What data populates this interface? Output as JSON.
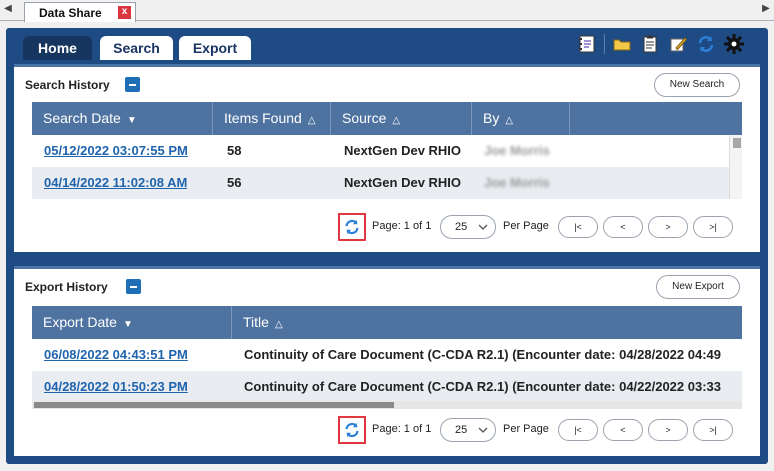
{
  "tabstrip": {
    "tab_label": "Data Share",
    "close_glyph": "x",
    "left_arrow": "◀",
    "right_arrow": "▶"
  },
  "nav": {
    "home": "Home",
    "search": "Search",
    "export": "Export"
  },
  "toolbar": {
    "icons": [
      "notes-icon",
      "folder-icon",
      "clipboard-icon",
      "edit-icon",
      "refresh-icon",
      "gear-icon"
    ]
  },
  "search_history": {
    "title": "Search History",
    "new_button": "New Search",
    "columns": [
      {
        "label": "Search Date",
        "sort": "▼"
      },
      {
        "label": "Items Found",
        "sort": "△"
      },
      {
        "label": "Source",
        "sort": "△"
      },
      {
        "label": "By",
        "sort": "△"
      }
    ],
    "rows": [
      {
        "date": "05/12/2022 03:07:55 PM",
        "items": "58",
        "source": "NextGen Dev RHIO",
        "by": "Joe Morris"
      },
      {
        "date": "04/14/2022 11:02:08 AM",
        "items": "56",
        "source": "NextGen Dev RHIO",
        "by": "Joe Morris"
      }
    ],
    "pager": {
      "page_text": "Page: 1 of 1",
      "page_size": "25",
      "per_page": "Per Page",
      "first": "|<",
      "prev": "<",
      "next": ">",
      "last": ">|"
    }
  },
  "export_history": {
    "title": "Export History",
    "new_button": "New Export",
    "columns": [
      {
        "label": "Export Date",
        "sort": "▼"
      },
      {
        "label": "Title",
        "sort": "△"
      }
    ],
    "rows": [
      {
        "date": "06/08/2022 04:43:51 PM",
        "title": "Continuity of Care Document (C-CDA R2.1) (Encounter date: 04/28/2022 04:49"
      },
      {
        "date": "04/28/2022 01:50:23 PM",
        "title": "Continuity of Care Document (C-CDA R2.1) (Encounter date: 04/22/2022 03:33"
      }
    ],
    "pager": {
      "page_text": "Page: 1 of 1",
      "page_size": "25",
      "per_page": "Per Page",
      "first": "|<",
      "prev": "<",
      "next": ">",
      "last": ">|"
    }
  },
  "colors": {
    "frame": "#1f4b84",
    "grid_header": "#4f73a1",
    "link": "#1f64ad",
    "highlight": "#e0383e"
  }
}
